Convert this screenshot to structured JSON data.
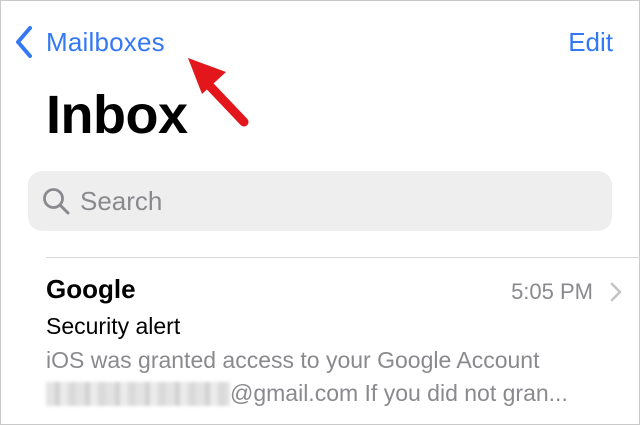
{
  "nav": {
    "back_label": "Mailboxes",
    "edit_label": "Edit"
  },
  "page": {
    "title": "Inbox"
  },
  "search": {
    "placeholder": "Search",
    "value": ""
  },
  "messages": [
    {
      "sender": "Google",
      "time": "5:05 PM",
      "subject": "Security alert",
      "preview_line1": "iOS was granted access to your Google Account",
      "preview_line2": "@gmail.com If you did not gran..."
    }
  ],
  "colors": {
    "accent": "#3478f6",
    "annotation_arrow": "#e3161c",
    "secondary_text": "#8a8a8e",
    "search_bg": "#eeeeef"
  },
  "icons": {
    "back": "chevron-left-icon",
    "search": "search-icon",
    "disclosure": "chevron-right-icon",
    "annotation": "red-arrow-icon"
  }
}
